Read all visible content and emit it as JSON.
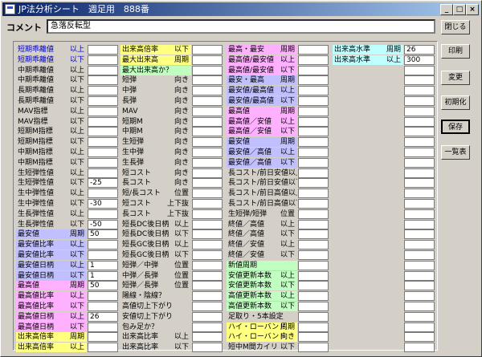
{
  "window": {
    "title": "JP法分析シート　週足用　888番"
  },
  "comment": {
    "label": "コメント",
    "value": "急落反転型"
  },
  "buttons": [
    "閉じる",
    "印刷",
    "変更",
    "初期化",
    "保存",
    "一覧表"
  ],
  "columns": [
    {
      "rows": [
        {
          "a": "短期乖離値",
          "b": "以上",
          "c": "blue",
          "v": ""
        },
        {
          "a": "短期乖離値",
          "b": "以下",
          "c": "blue",
          "v": ""
        },
        {
          "a": "中期乖離値",
          "b": "以上",
          "c": "",
          "v": ""
        },
        {
          "a": "中期乖離値",
          "b": "以下",
          "c": "",
          "v": ""
        },
        {
          "a": "長期乖離値",
          "b": "以上",
          "c": "",
          "v": ""
        },
        {
          "a": "長期乖離値",
          "b": "以下",
          "c": "",
          "v": ""
        },
        {
          "a": "MAV指標",
          "b": "以上",
          "c": "",
          "v": ""
        },
        {
          "a": "MAV指標",
          "b": "以下",
          "c": "",
          "v": ""
        },
        {
          "a": "短期M指標",
          "b": "以上",
          "c": "",
          "v": ""
        },
        {
          "a": "短期M指標",
          "b": "以下",
          "c": "",
          "v": ""
        },
        {
          "a": "中期M指標",
          "b": "以上",
          "c": "",
          "v": ""
        },
        {
          "a": "中期M指標",
          "b": "以下",
          "c": "",
          "v": ""
        },
        {
          "a": "生短弾性値",
          "b": "以上",
          "c": "",
          "v": ""
        },
        {
          "a": "生短弾性値",
          "b": "以下",
          "c": "",
          "v": "-25"
        },
        {
          "a": "生中弾性値",
          "b": "以上",
          "c": "",
          "v": ""
        },
        {
          "a": "生中弾性値",
          "b": "以下",
          "c": "",
          "v": "-30"
        },
        {
          "a": "生長弾性値",
          "b": "以上",
          "c": "",
          "v": ""
        },
        {
          "a": "生長弾性値",
          "b": "以下",
          "c": "",
          "v": "-50"
        },
        {
          "a": "最安値",
          "b": "周期",
          "c": "lav",
          "v": "50"
        },
        {
          "a": "最安値比率",
          "b": "以上",
          "c": "lav",
          "v": ""
        },
        {
          "a": "最安値比率",
          "b": "以下",
          "c": "lav",
          "v": ""
        },
        {
          "a": "最安値日柄",
          "b": "以上",
          "c": "lav",
          "v": "1"
        },
        {
          "a": "最安値日柄",
          "b": "以下",
          "c": "lav",
          "v": "1"
        },
        {
          "a": "最高値",
          "b": "周期",
          "c": "pink",
          "v": "50"
        },
        {
          "a": "最高値比率",
          "b": "以上",
          "c": "pink",
          "v": ""
        },
        {
          "a": "最高値比率",
          "b": "以下",
          "c": "pink",
          "v": ""
        },
        {
          "a": "最高値日柄",
          "b": "以上",
          "c": "pink",
          "v": "26"
        },
        {
          "a": "最高値日柄",
          "b": "以下",
          "c": "pink",
          "v": ""
        },
        {
          "a": "出来高倍率",
          "b": "周期",
          "c": "yel",
          "v": ""
        },
        {
          "a": "出来高倍率",
          "b": "以上",
          "c": "yel",
          "v": ""
        }
      ]
    },
    {
      "rows": [
        {
          "a": "出来高倍率",
          "b": "以下",
          "c": "yel",
          "v": ""
        },
        {
          "a": "最大出来高",
          "b": "周期",
          "c": "yel",
          "v": ""
        },
        {
          "a": "最大出来高か？",
          "b": "",
          "c": "grn",
          "v": ""
        },
        {
          "a": "短弾",
          "b": "向き",
          "c": "",
          "v": ""
        },
        {
          "a": "中弾",
          "b": "向き",
          "c": "",
          "v": ""
        },
        {
          "a": "長弾",
          "b": "向き",
          "c": "",
          "v": ""
        },
        {
          "a": "MAV",
          "b": "向き",
          "c": "",
          "v": ""
        },
        {
          "a": "短期M",
          "b": "向き",
          "c": "",
          "v": ""
        },
        {
          "a": "中期M",
          "b": "向き",
          "c": "",
          "v": ""
        },
        {
          "a": "生短弾",
          "b": "向き",
          "c": "",
          "v": ""
        },
        {
          "a": "生中弾",
          "b": "向き",
          "c": "",
          "v": ""
        },
        {
          "a": "生長弾",
          "b": "向き",
          "c": "",
          "v": ""
        },
        {
          "a": "短コスト",
          "b": "向き",
          "c": "",
          "v": ""
        },
        {
          "a": "長コスト",
          "b": "向き",
          "c": "",
          "v": ""
        },
        {
          "a": "短/長コスト",
          "b": "位置",
          "c": "",
          "v": ""
        },
        {
          "a": "短コスト",
          "b": "上下抜",
          "c": "",
          "v": ""
        },
        {
          "a": "長コスト",
          "b": "上下抜",
          "c": "",
          "v": ""
        },
        {
          "a": "短長DC後日柄",
          "b": "以上",
          "c": "",
          "v": ""
        },
        {
          "a": "短長DC後日柄",
          "b": "以下",
          "c": "",
          "v": ""
        },
        {
          "a": "短長GC後日柄",
          "b": "以上",
          "c": "",
          "v": ""
        },
        {
          "a": "短長GC後日柄",
          "b": "以下",
          "c": "",
          "v": ""
        },
        {
          "a": "短弾／中弾",
          "b": "位置",
          "c": "",
          "v": ""
        },
        {
          "a": "中弾／長弾",
          "b": "位置",
          "c": "",
          "v": ""
        },
        {
          "a": "短弾／長弾",
          "b": "位置",
          "c": "",
          "v": ""
        },
        {
          "a": "陽線・陰線？",
          "b": "",
          "c": "",
          "v": ""
        },
        {
          "a": "高値切上下がり",
          "b": "",
          "c": "",
          "v": ""
        },
        {
          "a": "安値切上下がり",
          "b": "",
          "c": "",
          "v": ""
        },
        {
          "a": "包み足か？",
          "b": "",
          "c": "",
          "v": ""
        },
        {
          "a": "出来高比率",
          "b": "以上",
          "c": "",
          "v": ""
        },
        {
          "a": "出来高比率",
          "b": "以下",
          "c": "",
          "v": ""
        }
      ]
    },
    {
      "rows": [
        {
          "a": "最高・最安",
          "b": "周期",
          "c": "pink",
          "v": ""
        },
        {
          "a": "最高値/最安値",
          "b": "以上",
          "c": "pink",
          "v": ""
        },
        {
          "a": "最高値/最安値",
          "b": "以下",
          "c": "pink",
          "v": ""
        },
        {
          "a": "最安・最高",
          "b": "周期",
          "c": "lav",
          "v": ""
        },
        {
          "a": "最安値/最高値",
          "b": "以上",
          "c": "lav",
          "v": ""
        },
        {
          "a": "最安値/最高値",
          "b": "以下",
          "c": "lav",
          "v": ""
        },
        {
          "a": "最高値",
          "b": "周期",
          "c": "pink",
          "v": ""
        },
        {
          "a": "最高値／安値",
          "b": "以上",
          "c": "pink",
          "v": ""
        },
        {
          "a": "最高値／安値",
          "b": "以下",
          "c": "pink",
          "v": ""
        },
        {
          "a": "最安値",
          "b": "周期",
          "c": "lav",
          "v": ""
        },
        {
          "a": "最安値／高値",
          "b": "以上",
          "c": "lav",
          "v": ""
        },
        {
          "a": "最安値／高値",
          "b": "以下",
          "c": "lav",
          "v": ""
        },
        {
          "a": "長コスト/前日安値以上",
          "b": "",
          "c": "",
          "v": ""
        },
        {
          "a": "長コスト/前日安値以下",
          "b": "",
          "c": "",
          "v": ""
        },
        {
          "a": "長コスト/前日高値以上",
          "b": "",
          "c": "",
          "v": ""
        },
        {
          "a": "長コスト/前日高値以下",
          "b": "",
          "c": "",
          "v": ""
        },
        {
          "a": "生短弾/短弾",
          "b": "位置",
          "c": "",
          "v": ""
        },
        {
          "a": "終値／高値",
          "b": "以上",
          "c": "",
          "v": ""
        },
        {
          "a": "終値／高値",
          "b": "以下",
          "c": "",
          "v": ""
        },
        {
          "a": "終値／安値",
          "b": "以上",
          "c": "",
          "v": ""
        },
        {
          "a": "終値／安値",
          "b": "以下",
          "c": "",
          "v": ""
        },
        {
          "a": "新値周期",
          "b": "",
          "c": "grn",
          "v": ""
        },
        {
          "a": "安値更新本数",
          "b": "以上",
          "c": "grn",
          "v": ""
        },
        {
          "a": "安値更新本数",
          "b": "以下",
          "c": "grn",
          "v": ""
        },
        {
          "a": "高値更新本数",
          "b": "以上",
          "c": "grn",
          "v": ""
        },
        {
          "a": "高値更新本数",
          "b": "以下",
          "c": "grn",
          "v": ""
        },
        {
          "a": "足取り・5本設定",
          "b": "",
          "c": "",
          "v": ""
        },
        {
          "a": "ハイ・ローバンド",
          "b": "周期",
          "c": "yel",
          "v": ""
        },
        {
          "a": "ハイ・ローバンド",
          "b": "向き",
          "c": "yel",
          "v": ""
        },
        {
          "a": "短中M間カイリ",
          "b": "以下",
          "c": "",
          "v": ""
        }
      ]
    },
    {
      "rows": [
        {
          "a": "出来高水準",
          "b": "周期",
          "c": "cyan",
          "v": "26"
        },
        {
          "a": "出来高水準",
          "b": "以上",
          "c": "cyan",
          "v": "300"
        },
        {
          "a": "",
          "b": "",
          "c": "",
          "v": ""
        },
        {
          "a": "",
          "b": "",
          "c": "",
          "v": ""
        },
        {
          "a": "",
          "b": "",
          "c": "",
          "v": ""
        },
        {
          "a": "",
          "b": "",
          "c": "",
          "v": ""
        },
        {
          "a": "",
          "b": "",
          "c": "",
          "v": ""
        },
        {
          "a": "",
          "b": "",
          "c": "",
          "v": ""
        },
        {
          "a": "",
          "b": "",
          "c": "",
          "v": ""
        },
        {
          "a": "",
          "b": "",
          "c": "",
          "v": ""
        },
        {
          "a": "",
          "b": "",
          "c": "",
          "v": ""
        },
        {
          "a": "",
          "b": "",
          "c": "",
          "v": ""
        },
        {
          "a": "",
          "b": "",
          "c": "",
          "v": ""
        },
        {
          "a": "",
          "b": "",
          "c": "",
          "v": ""
        },
        {
          "a": "",
          "b": "",
          "c": "",
          "v": ""
        },
        {
          "a": "",
          "b": "",
          "c": "",
          "v": ""
        },
        {
          "a": "",
          "b": "",
          "c": "",
          "v": ""
        },
        {
          "a": "",
          "b": "",
          "c": "",
          "v": ""
        },
        {
          "a": "",
          "b": "",
          "c": "",
          "v": ""
        },
        {
          "a": "",
          "b": "",
          "c": "",
          "v": ""
        },
        {
          "a": "",
          "b": "",
          "c": "",
          "v": ""
        },
        {
          "a": "",
          "b": "",
          "c": "",
          "v": ""
        },
        {
          "a": "",
          "b": "",
          "c": "",
          "v": ""
        },
        {
          "a": "",
          "b": "",
          "c": "",
          "v": ""
        },
        {
          "a": "",
          "b": "",
          "c": "",
          "v": ""
        },
        {
          "a": "",
          "b": "",
          "c": "",
          "v": ""
        },
        {
          "a": "",
          "b": "",
          "c": "",
          "v": ""
        },
        {
          "a": "",
          "b": "",
          "c": "",
          "v": ""
        },
        {
          "a": "",
          "b": "",
          "c": "",
          "v": ""
        },
        {
          "a": "",
          "b": "",
          "c": "",
          "v": ""
        }
      ]
    }
  ]
}
